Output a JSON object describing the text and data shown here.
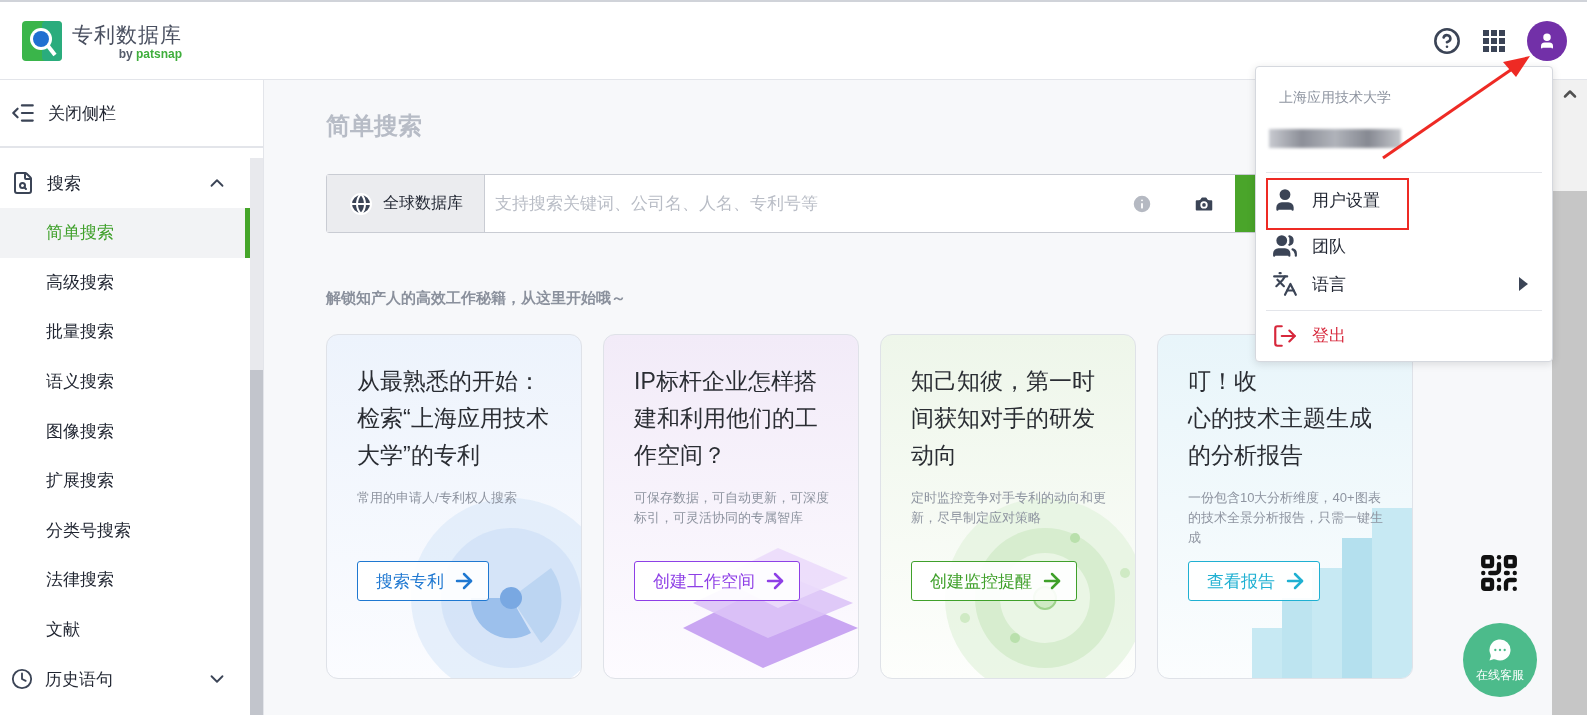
{
  "header": {
    "logo_title": "专利数据库",
    "logo_by": "by",
    "logo_brand": "patsnap"
  },
  "sidebar": {
    "close_label": "关闭侧栏",
    "sections": [
      {
        "kind": "search",
        "label": "搜索",
        "expanded": true,
        "items": [
          {
            "label": "简单搜索",
            "selected": true
          },
          {
            "label": "高级搜索",
            "selected": false
          },
          {
            "label": "批量搜索",
            "selected": false
          },
          {
            "label": "语义搜索",
            "selected": false
          },
          {
            "label": "图像搜索",
            "selected": false
          },
          {
            "label": "扩展搜索",
            "selected": false
          },
          {
            "label": "分类号搜索",
            "selected": false
          },
          {
            "label": "法律搜索",
            "selected": false
          },
          {
            "label": "文献",
            "selected": false
          }
        ]
      },
      {
        "kind": "history",
        "label": "历史语句",
        "expanded": false
      }
    ]
  },
  "main": {
    "title": "简单搜索",
    "search": {
      "database": "全球数据库",
      "placeholder": "支持搜索关键词、公司名、人名、专利号等"
    },
    "tagline": "解锁知产人的高效工作秘籍，从这里开始哦～",
    "cards": [
      {
        "kind": "radar",
        "color": "#1f78d1",
        "title_lines": [
          "从最熟悉的开始：",
          "检索“上海应用技术",
          "大学”的专利"
        ],
        "description": "常用的申请人/专利权人搜索",
        "action": "搜索专利"
      },
      {
        "kind": "layers",
        "color": "#8e3fe6",
        "title_lines": [
          "IP标杆企业怎样搭",
          "建和利用他们的工",
          "作空间？"
        ],
        "description": "可保存数据，可自动更新，可深度标引，可灵活协同的专属智库",
        "action": "创建工作空间"
      },
      {
        "kind": "rings",
        "color": "#3fa02a",
        "title_lines": [
          "知己知彼，第一时",
          "间获知对手的研发",
          "动向"
        ],
        "description": "定时监控竞争对手专利的动向和更新，尽早制定应对策略",
        "action": "创建监控提醒"
      },
      {
        "kind": "bars",
        "color": "#1fb0d2",
        "title_lines": [
          "叮！收",
          "心的技术主题生成",
          "的分析报告"
        ],
        "description": "一份包含10大分析维度，40+图表的技术全景分析报告，只需一键生成",
        "action": "查看报告"
      }
    ]
  },
  "user_menu": {
    "organization": "上海应用技术大学",
    "items": [
      {
        "kind": "user",
        "label": "用户设置",
        "highlighted": true
      },
      {
        "kind": "team",
        "label": "团队",
        "highlighted": false
      },
      {
        "kind": "language",
        "label": "语言",
        "highlighted": false
      },
      {
        "kind": "logout",
        "label": "登出",
        "highlighted": false
      }
    ]
  },
  "chat": {
    "label": "在线客服"
  }
}
